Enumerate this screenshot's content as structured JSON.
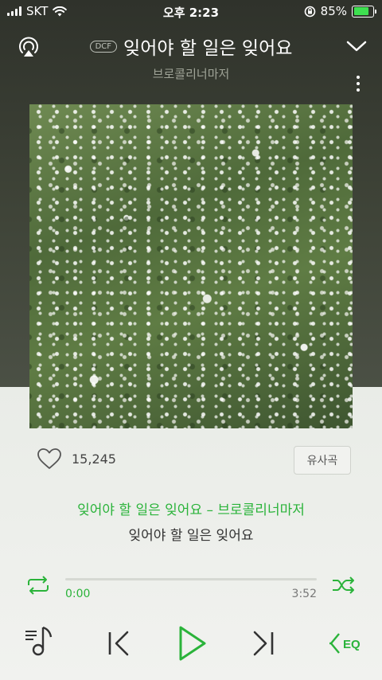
{
  "status_bar": {
    "carrier": "SKT",
    "time": "오후 2:23",
    "battery": "85%",
    "battery_level": 0.85
  },
  "header": {
    "badge": "DCF",
    "title": "잊어야 할 일은 잊어요",
    "artist": "브로콜리너마저"
  },
  "like": {
    "count": "15,245"
  },
  "similar_button": "유사곡",
  "lyrics": {
    "current": "잊어야 할 일은 잊어요 – 브로콜리너마저",
    "next": "잊어야 할 일은 잊어요"
  },
  "progress": {
    "current": "0:00",
    "total": "3:52",
    "fraction": 0
  },
  "colors": {
    "accent": "#2ab33a",
    "dark_bg": "#3f4438",
    "light_bg": "#eef0ec"
  },
  "icons": [
    "airplay-icon",
    "chevron-down-icon",
    "more-icon",
    "heart-icon",
    "repeat-icon",
    "shuffle-icon",
    "playlist-icon",
    "previous-icon",
    "play-icon",
    "next-icon",
    "equalizer-icon"
  ]
}
